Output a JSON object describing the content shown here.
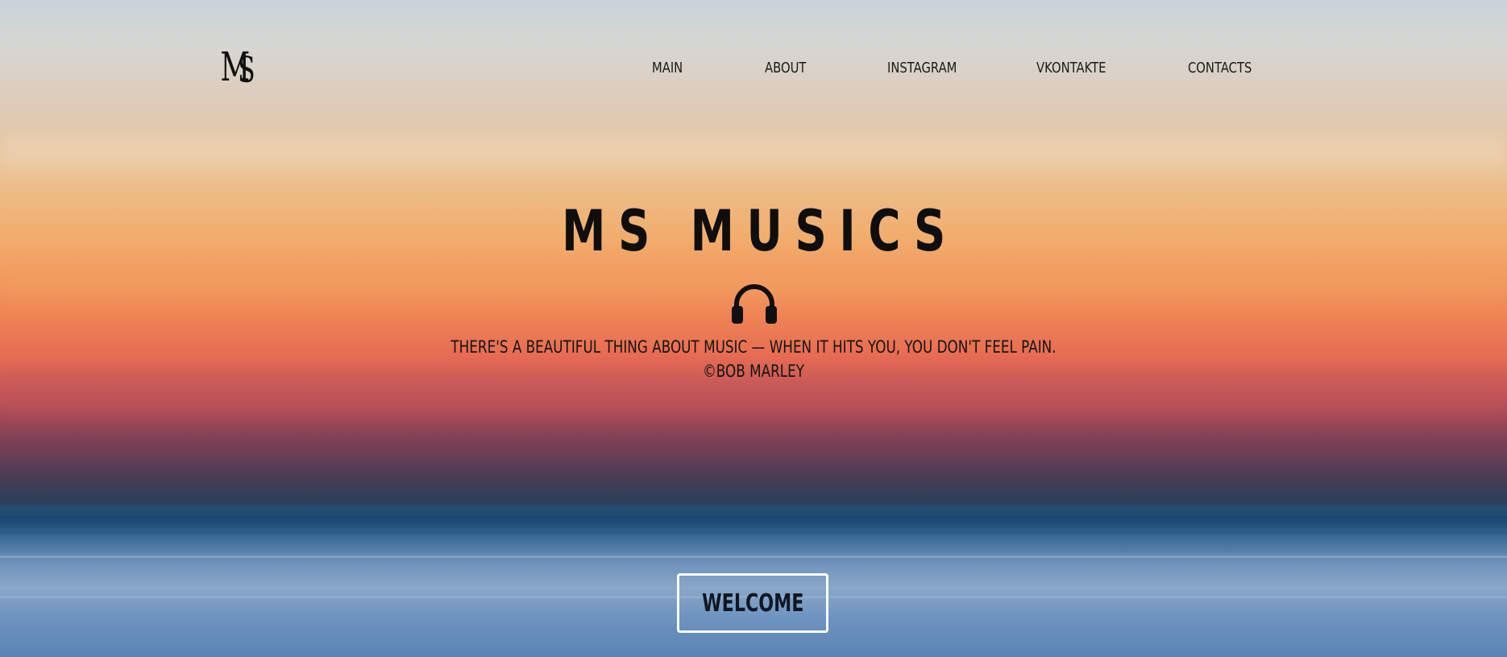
{
  "brand": {
    "logo_text": "MS",
    "logo_icon": "ms-monogram-logo"
  },
  "nav": {
    "items": [
      {
        "label": "MAIN"
      },
      {
        "label": "ABOUT"
      },
      {
        "label": "INSTAGRAM"
      },
      {
        "label": "VKONTAKTE"
      },
      {
        "label": "CONTACTS"
      }
    ]
  },
  "hero": {
    "title": "MS MUSICS",
    "icon": "headphones-icon",
    "quote_line1": "THERE'S A BEAUTIFUL THING ABOUT MUSIC — WHEN IT HITS YOU, YOU DON'T FEEL PAIN.",
    "quote_line2": "©BOB MARLEY",
    "cta_label": "WELCOME"
  },
  "colors": {
    "text": "#111111",
    "button_border": "#ffffff",
    "sky_top": "#c9d4da",
    "sunset_orange": "#ef8a55",
    "sea_blue": "#5a84b5"
  }
}
